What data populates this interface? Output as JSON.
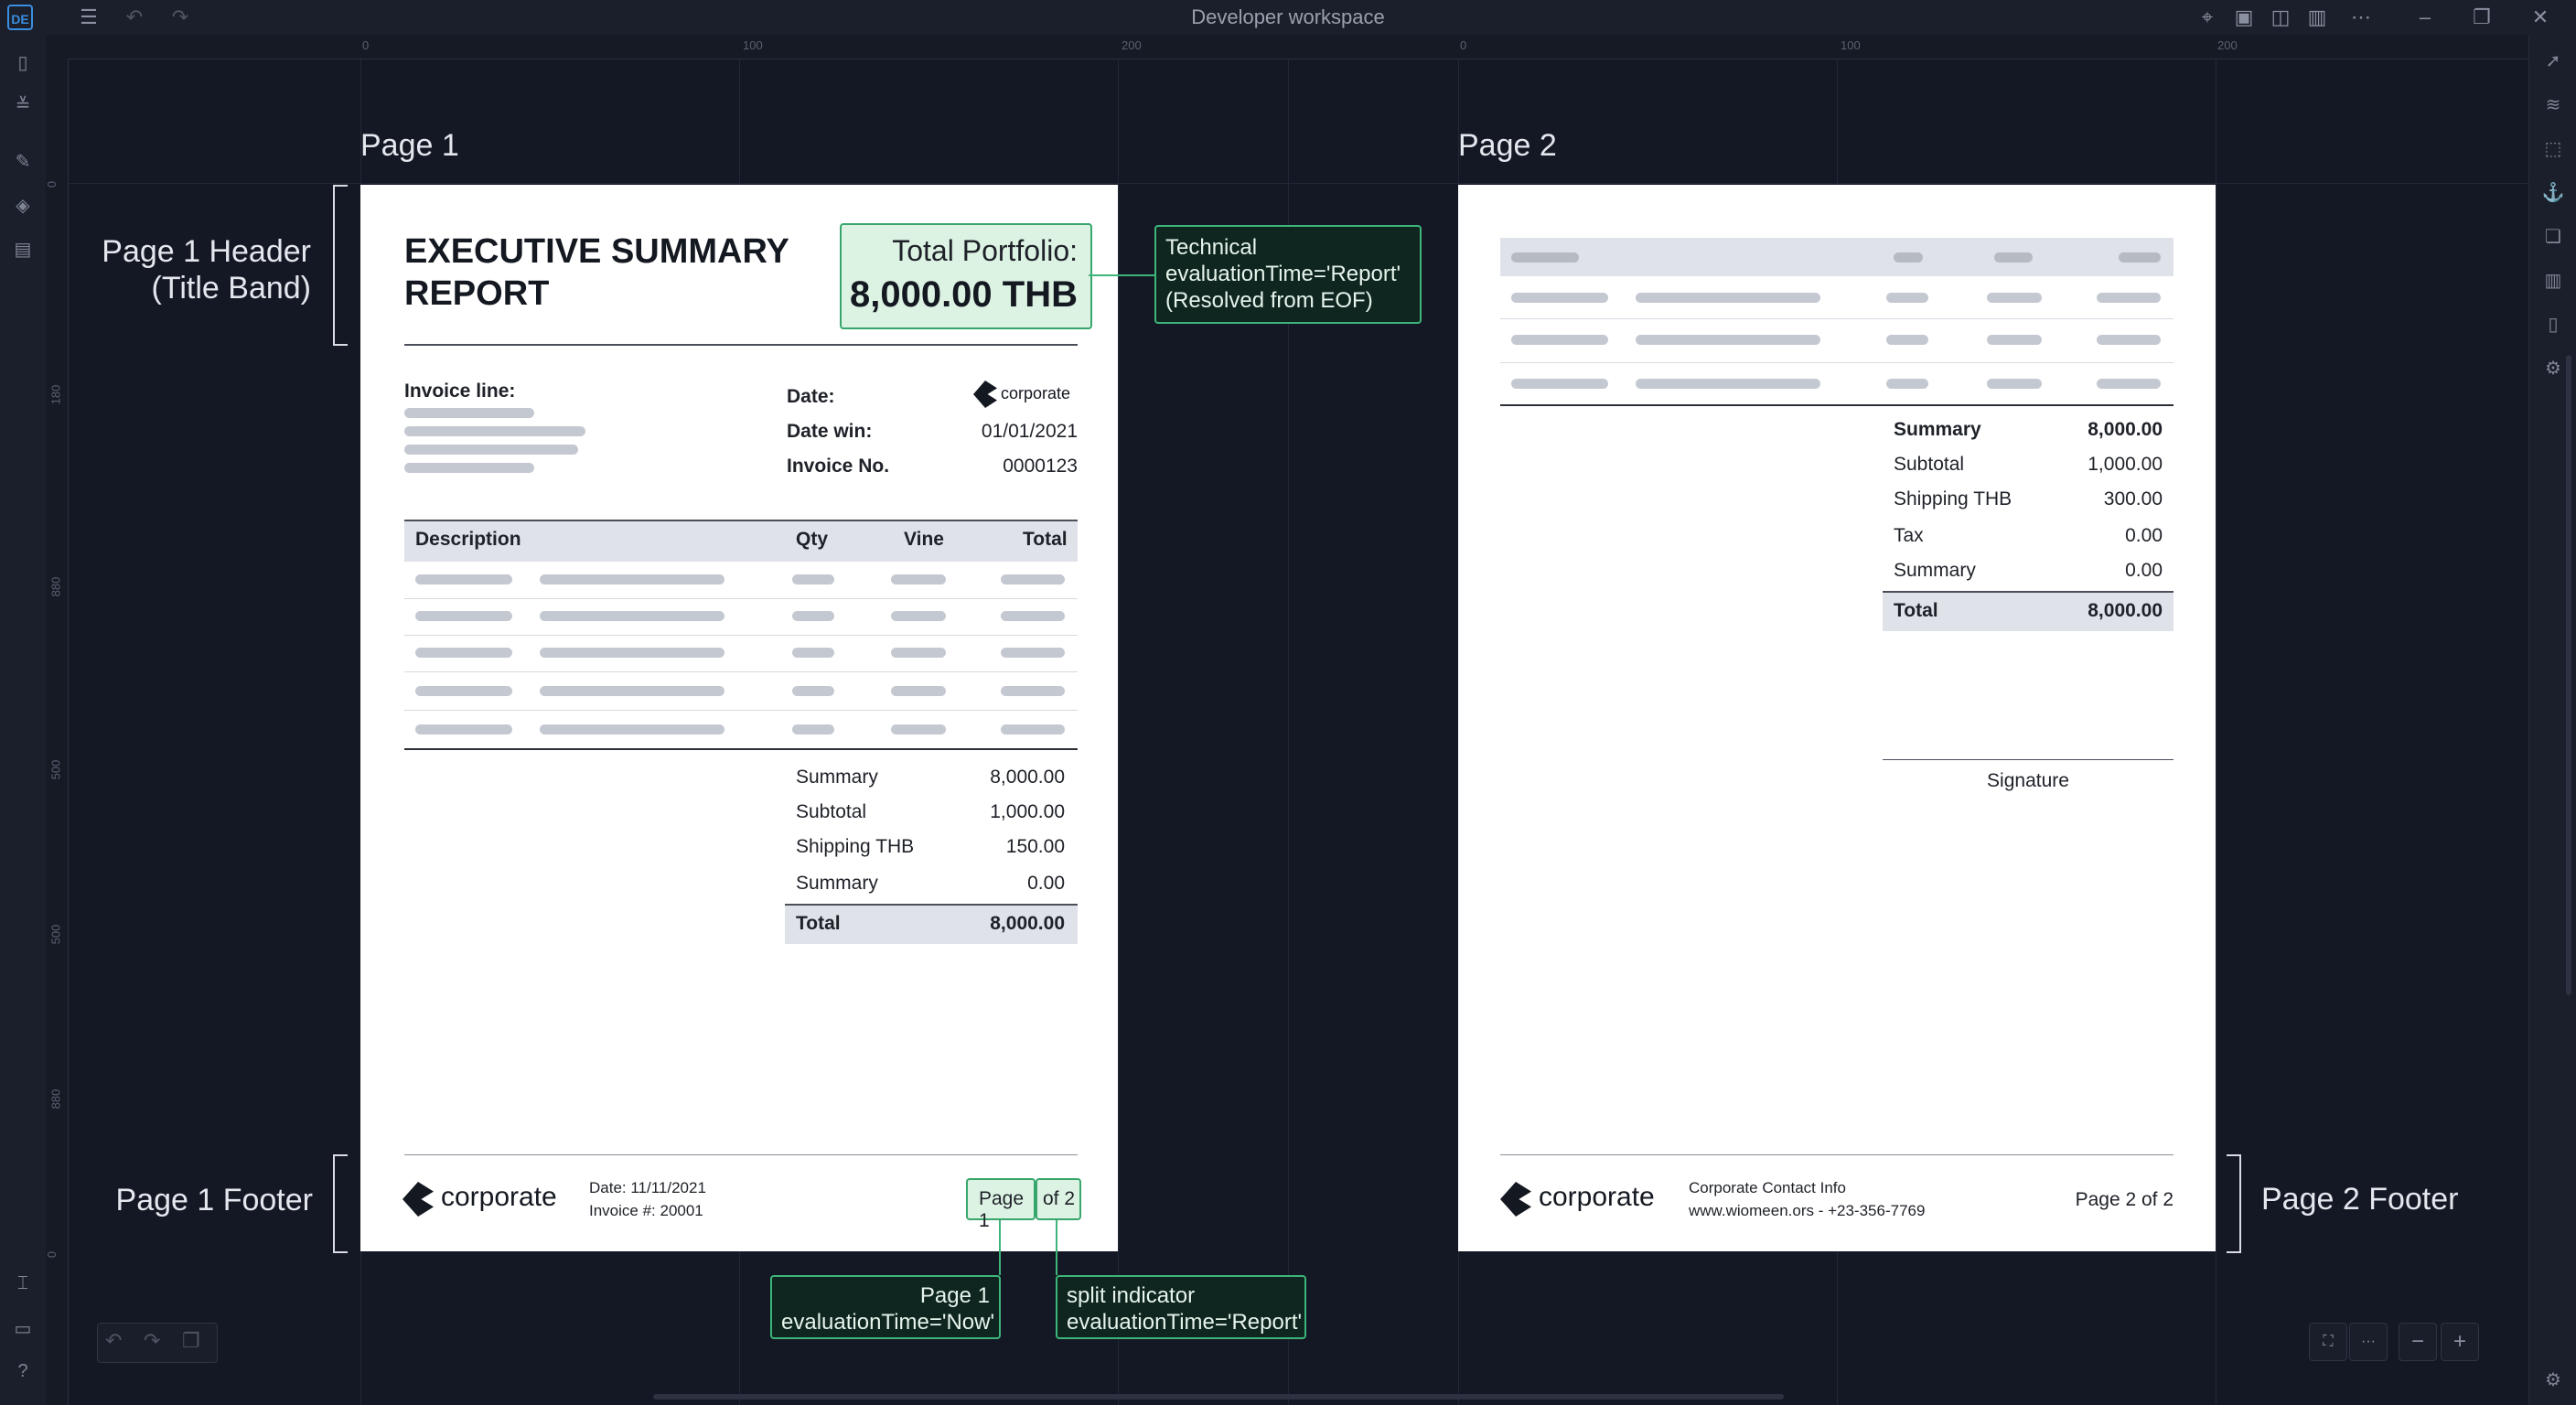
{
  "window": {
    "title": "Developer workspace",
    "app_logo": "DE"
  },
  "toolbar": {
    "icons": [
      "menu-icon",
      "undo-icon",
      "redo-icon"
    ],
    "right_icons": [
      "cursor-icon",
      "frame-icon",
      "layout-icon",
      "panel-icon",
      "more-icon"
    ]
  },
  "rulers": {
    "top": [
      "0",
      "100",
      "200",
      "0",
      "100",
      "200"
    ],
    "left": [
      "0",
      "180",
      "880",
      "500",
      "500",
      "880",
      "0"
    ]
  },
  "canvas": {
    "page1_label": "Page 1",
    "page2_label": "Page 2",
    "page1_header_label_line1": "Page 1 Header",
    "page1_header_label_line2": "(Title Band)",
    "page1_footer_label": "Page 1 Footer",
    "page2_footer_label": "Page 2 Footer"
  },
  "page1": {
    "title_line1": "EXECUTIVE SUMMARY",
    "title_line2": "REPORT",
    "portfolio_label": "Total Portfolio:",
    "portfolio_value": "8,000.00 THB",
    "invoice_line_label": "Invoice line:",
    "brand_small": "corporate",
    "meta": [
      {
        "label": "Date:",
        "value": ""
      },
      {
        "label": "Date win:",
        "value": "01/01/2021"
      },
      {
        "label": "Invoice No.",
        "value": "0000123"
      }
    ],
    "table_headers": [
      "Description",
      "Qty",
      "Vine",
      "Total"
    ],
    "totals": [
      {
        "label": "Summary",
        "value": "8,000.00"
      },
      {
        "label": "Subtotal",
        "value": "1,000.00"
      },
      {
        "label": "Shipping THB",
        "value": "150.00"
      },
      {
        "label": "Summary",
        "value": "0.00"
      }
    ],
    "grand_total_label": "Total",
    "grand_total_value": "8,000.00",
    "footer_brand": "corporate",
    "footer_date": "Date: 11/11/2021",
    "footer_invoice": "Invoice #: 20001",
    "page_part1": "Page 1",
    "page_part2": "of 2"
  },
  "page2": {
    "totals": [
      {
        "label": "Summary",
        "value": "8,000.00"
      },
      {
        "label": "Subtotal",
        "value": "1,000.00"
      },
      {
        "label": "Shipping THB",
        "value": "300.00"
      },
      {
        "label": "Tax",
        "value": "0.00"
      },
      {
        "label": "Summary",
        "value": "0.00"
      }
    ],
    "grand_total_label": "Total",
    "grand_total_value": "8,000.00",
    "signature_label": "Signature",
    "footer_brand": "corporate",
    "contact_title": "Corporate Contact Info",
    "contact_line": "www.wiomeen.ors - +23-356-7769",
    "page_text": "Page 2 of 2"
  },
  "callouts": {
    "technical_line1": "Technical",
    "technical_line2": "evaluationTime='Report'",
    "technical_line3": "(Resolved from EOF)",
    "page_now_line1": "Page 1",
    "page_now_line2": "evaluationTime='Now'",
    "split_line1": "split indicator",
    "split_line2": "evaluationTime='Report'"
  },
  "bottom_controls": {
    "zoom_out": "−",
    "zoom_in": "+",
    "zoom_level": "···"
  }
}
